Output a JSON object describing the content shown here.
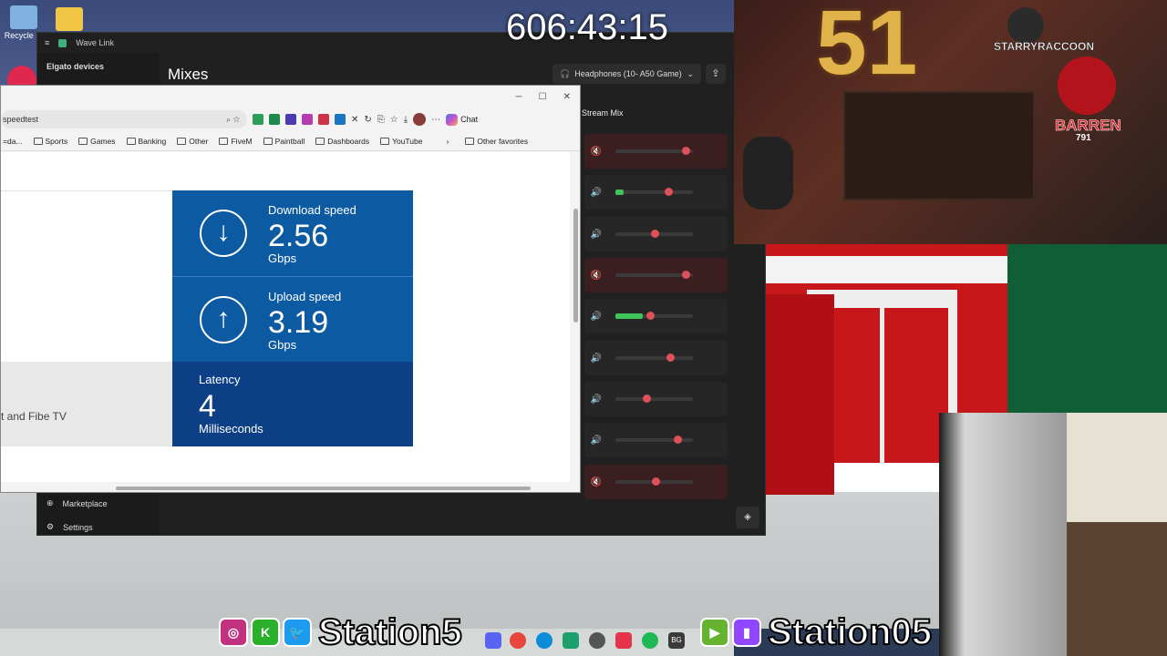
{
  "timer": "606:43:15",
  "desktop": {
    "icons": [
      {
        "label": "Recycle Bi",
        "icon": "recycle-bin-icon"
      },
      {
        "label": "",
        "icon": "folder-icon"
      }
    ]
  },
  "wavelink": {
    "title": "Wave Link",
    "sidebar": {
      "header": "Elgato devices",
      "bottom_items": [
        {
          "label": "Marketplace",
          "icon": "marketplace-icon"
        },
        {
          "label": "Settings",
          "icon": "gear-icon"
        }
      ]
    },
    "heading": "Mixes",
    "output_device": "Headphones (10- A50 Game)",
    "mix_header": "Stream Mix",
    "channels": [
      {
        "muted": true,
        "level": 0.9,
        "meter": 0.0
      },
      {
        "muted": false,
        "level": 0.68,
        "meter": 0.1
      },
      {
        "muted": false,
        "level": 0.5,
        "meter": 0.0
      },
      {
        "muted": true,
        "level": 0.9,
        "meter": 0.0
      },
      {
        "muted": false,
        "level": 0.45,
        "meter": 0.35
      },
      {
        "muted": false,
        "level": 0.7,
        "meter": 0.0
      },
      {
        "muted": false,
        "level": 0.4,
        "meter": 0.0
      },
      {
        "muted": false,
        "level": 0.8,
        "meter": 0.0
      },
      {
        "muted": true,
        "level": 0.52,
        "meter": 0.0
      }
    ],
    "accent": "#e0505a",
    "meter_color": "#3ec45a"
  },
  "browser": {
    "controls": {
      "minimize": "─",
      "maximize": "☐",
      "close": "✕"
    },
    "url": "speedtest",
    "chat_label": "Chat",
    "favorites": [
      "=da...",
      "Sports",
      "Games",
      "Banking",
      "Other",
      "FiveM",
      "Paintball",
      "Dashboards",
      "YouTube"
    ],
    "other_favorites": "Other favorites",
    "partial_text": "t and Fibe TV",
    "speed": {
      "download": {
        "label": "Download speed",
        "value": "2.56",
        "unit": "Gbps"
      },
      "upload": {
        "label": "Upload speed",
        "value": "3.19",
        "unit": "Gbps"
      },
      "latency": {
        "label": "Latency",
        "value": "4",
        "unit": "Milliseconds"
      }
    },
    "tile_color": "#0c5aa2",
    "latency_color": "#0c3f86"
  },
  "stream_overlay": {
    "logos": {
      "raccoon": "STARRYRACCOON",
      "barren": "BARREN",
      "barren_sub": "791"
    },
    "balloon_number": "51",
    "handles": {
      "left": "Station5",
      "right": "Station05"
    },
    "social_icons_left": [
      "instagram-icon",
      "kick-icon",
      "twitter-icon"
    ],
    "social_icons_right": [
      "rumble-icon",
      "twitch-icon"
    ]
  }
}
